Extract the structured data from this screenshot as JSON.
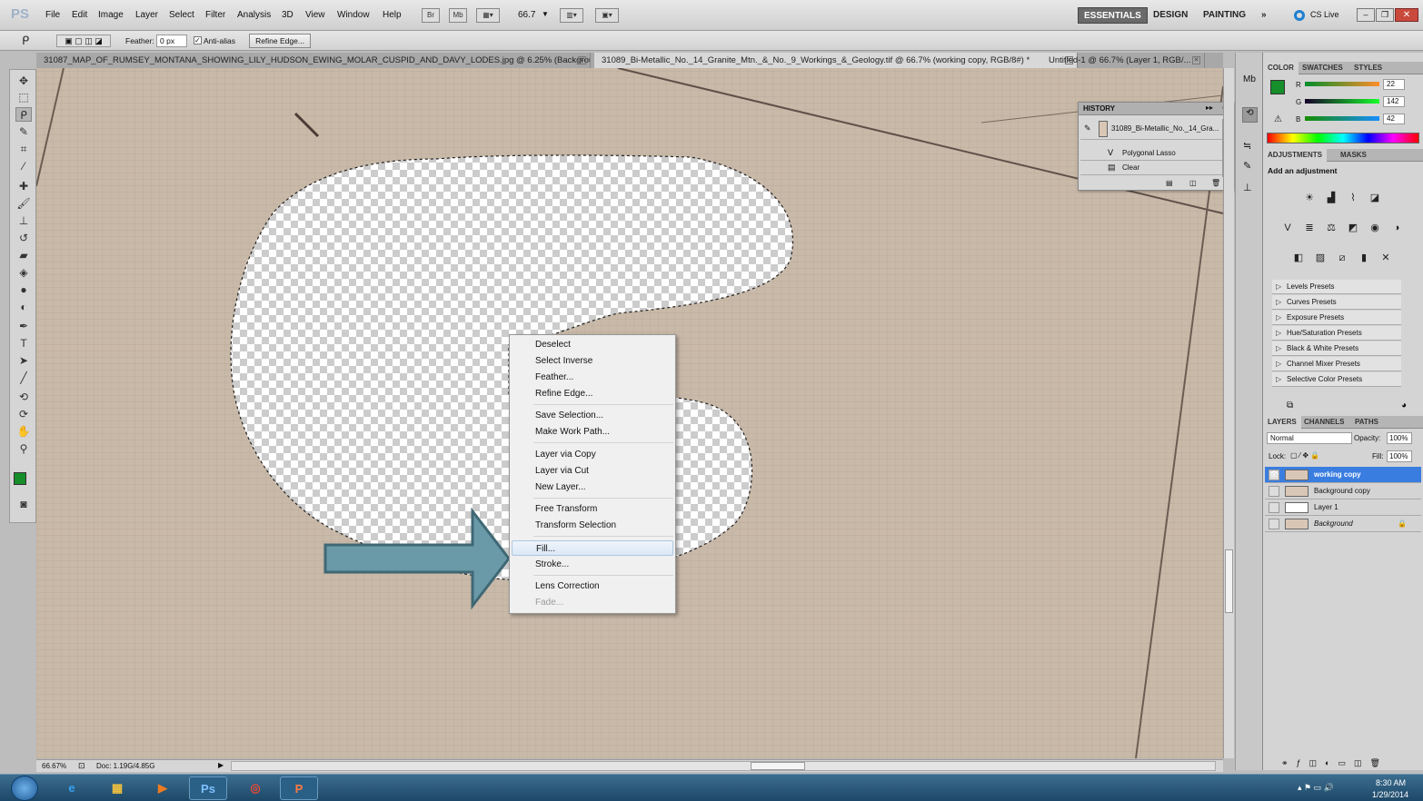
{
  "menubar": {
    "logo": "PS",
    "items": [
      "File",
      "Edit",
      "Image",
      "Layer",
      "Select",
      "Filter",
      "Analysis",
      "3D",
      "View",
      "Window",
      "Help"
    ],
    "bridge": "Br",
    "minibridge": "Mb",
    "zoom": "66.7",
    "workspaces": [
      "ESSENTIALS",
      "DESIGN",
      "PAINTING"
    ],
    "more": "»",
    "cslive": "CS Live"
  },
  "options": {
    "feather_label": "Feather:",
    "feather_value": "0 px",
    "antialias_label": "Anti-alias",
    "refine_edge": "Refine Edge..."
  },
  "doc_tabs": [
    {
      "label": "31087_MAP_OF_RUMSEY_MONTANA_SHOWING_LILY_HUDSON_EWING_MOLAR_CUSPID_AND_DAVY_LODES.jpg @ 6.25% (Backgroun..."
    },
    {
      "label": "31089_Bi-Metallic_No._14_Granite_Mtn._&_No._9_Workings_&_Geology.tif @ 66.7% (working copy, RGB/8#) *"
    },
    {
      "label": "Untitled-1 @ 66.7% (Layer 1, RGB/..."
    }
  ],
  "status": {
    "zoom": "66.67%",
    "doc": "Doc: 1.19G/4.85G"
  },
  "history": {
    "title": "HISTORY",
    "snapshot": "31089_Bi-Metallic_No._14_Gra...",
    "items": [
      "Polygonal Lasso",
      "Clear"
    ]
  },
  "context_menu": {
    "groups": [
      [
        "Deselect",
        "Select Inverse",
        "Feather...",
        "Refine Edge..."
      ],
      [
        "Save Selection...",
        "Make Work Path..."
      ],
      [
        "Layer via Copy",
        "Layer via Cut",
        "New Layer..."
      ],
      [
        "Free Transform",
        "Transform Selection"
      ],
      [
        "Fill...",
        "Stroke..."
      ],
      [
        "Lens Correction",
        "Fade..."
      ]
    ],
    "highlighted": "Fill...",
    "disabled": "Fade..."
  },
  "color_panel": {
    "tabs": [
      "COLOR",
      "SWATCHES",
      "STYLES"
    ],
    "channels": [
      {
        "label": "R",
        "value": "22"
      },
      {
        "label": "G",
        "value": "142"
      },
      {
        "label": "B",
        "value": "42"
      }
    ],
    "fg_color": "#168e2a"
  },
  "adjustments": {
    "tabs": [
      "ADJUSTMENTS",
      "MASKS"
    ],
    "heading": "Add an adjustment",
    "presets": [
      "Levels Presets",
      "Curves Presets",
      "Exposure Presets",
      "Hue/Saturation Presets",
      "Black & White Presets",
      "Channel Mixer Presets",
      "Selective Color Presets"
    ]
  },
  "layers": {
    "tabs": [
      "LAYERS",
      "CHANNELS",
      "PATHS"
    ],
    "blend": "Normal",
    "opacity_label": "Opacity:",
    "opacity": "100%",
    "lock_label": "Lock:",
    "fill_label": "Fill:",
    "fill": "100%",
    "rows": [
      "working copy",
      "Background copy",
      "Layer 1",
      "Background"
    ]
  },
  "taskbar": {
    "time": "8:30 AM",
    "date": "1/29/2014",
    "ps": "Ps"
  }
}
